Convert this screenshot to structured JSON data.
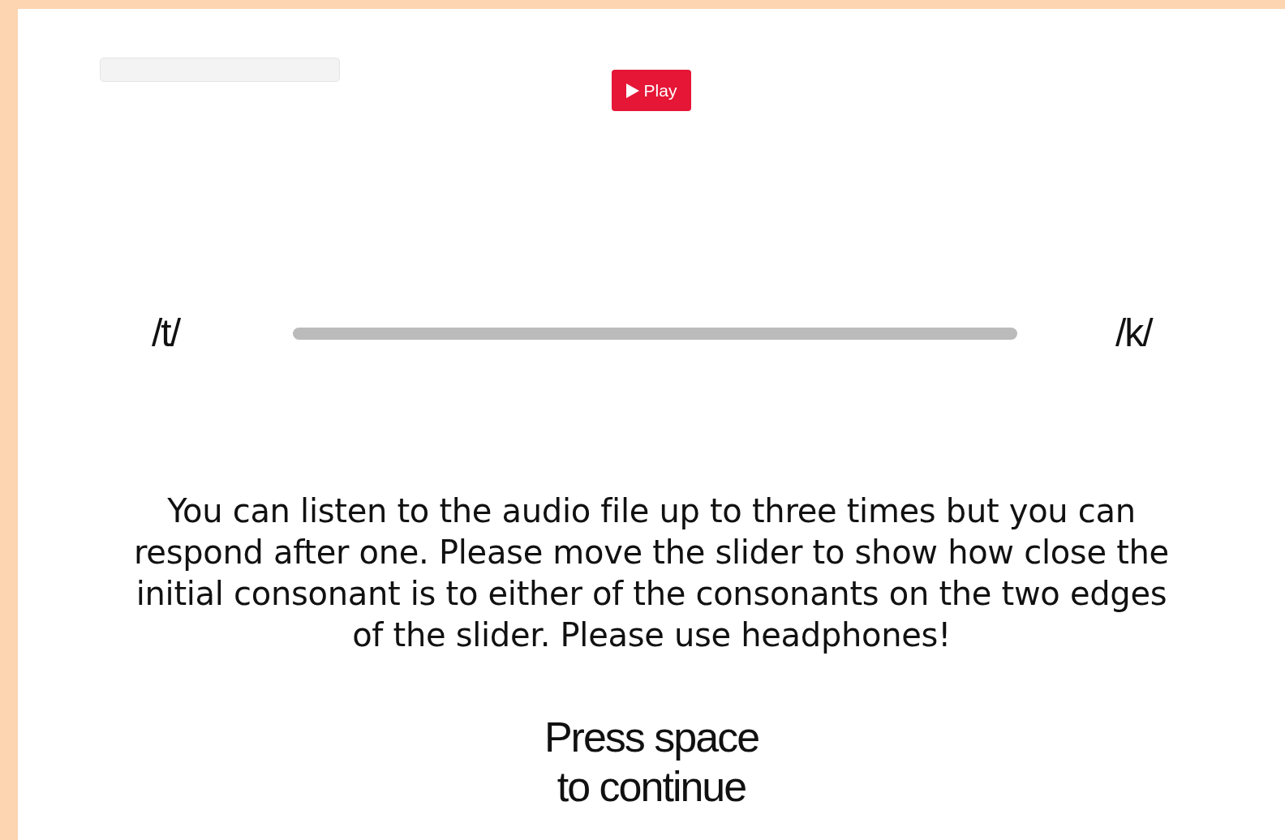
{
  "progress": {
    "level": 0
  },
  "play_button": {
    "label": "Play"
  },
  "slider": {
    "left_label": "/t/",
    "right_label": "/k/"
  },
  "instructions": "You can listen to the audio file up to three times but you can respond after one. Please move the slider to show how close the initial consonant is to either of the consonants on the two edges of the slider. Please use headphones!",
  "continue_prompt": [
    "Press space",
    "to continue"
  ]
}
